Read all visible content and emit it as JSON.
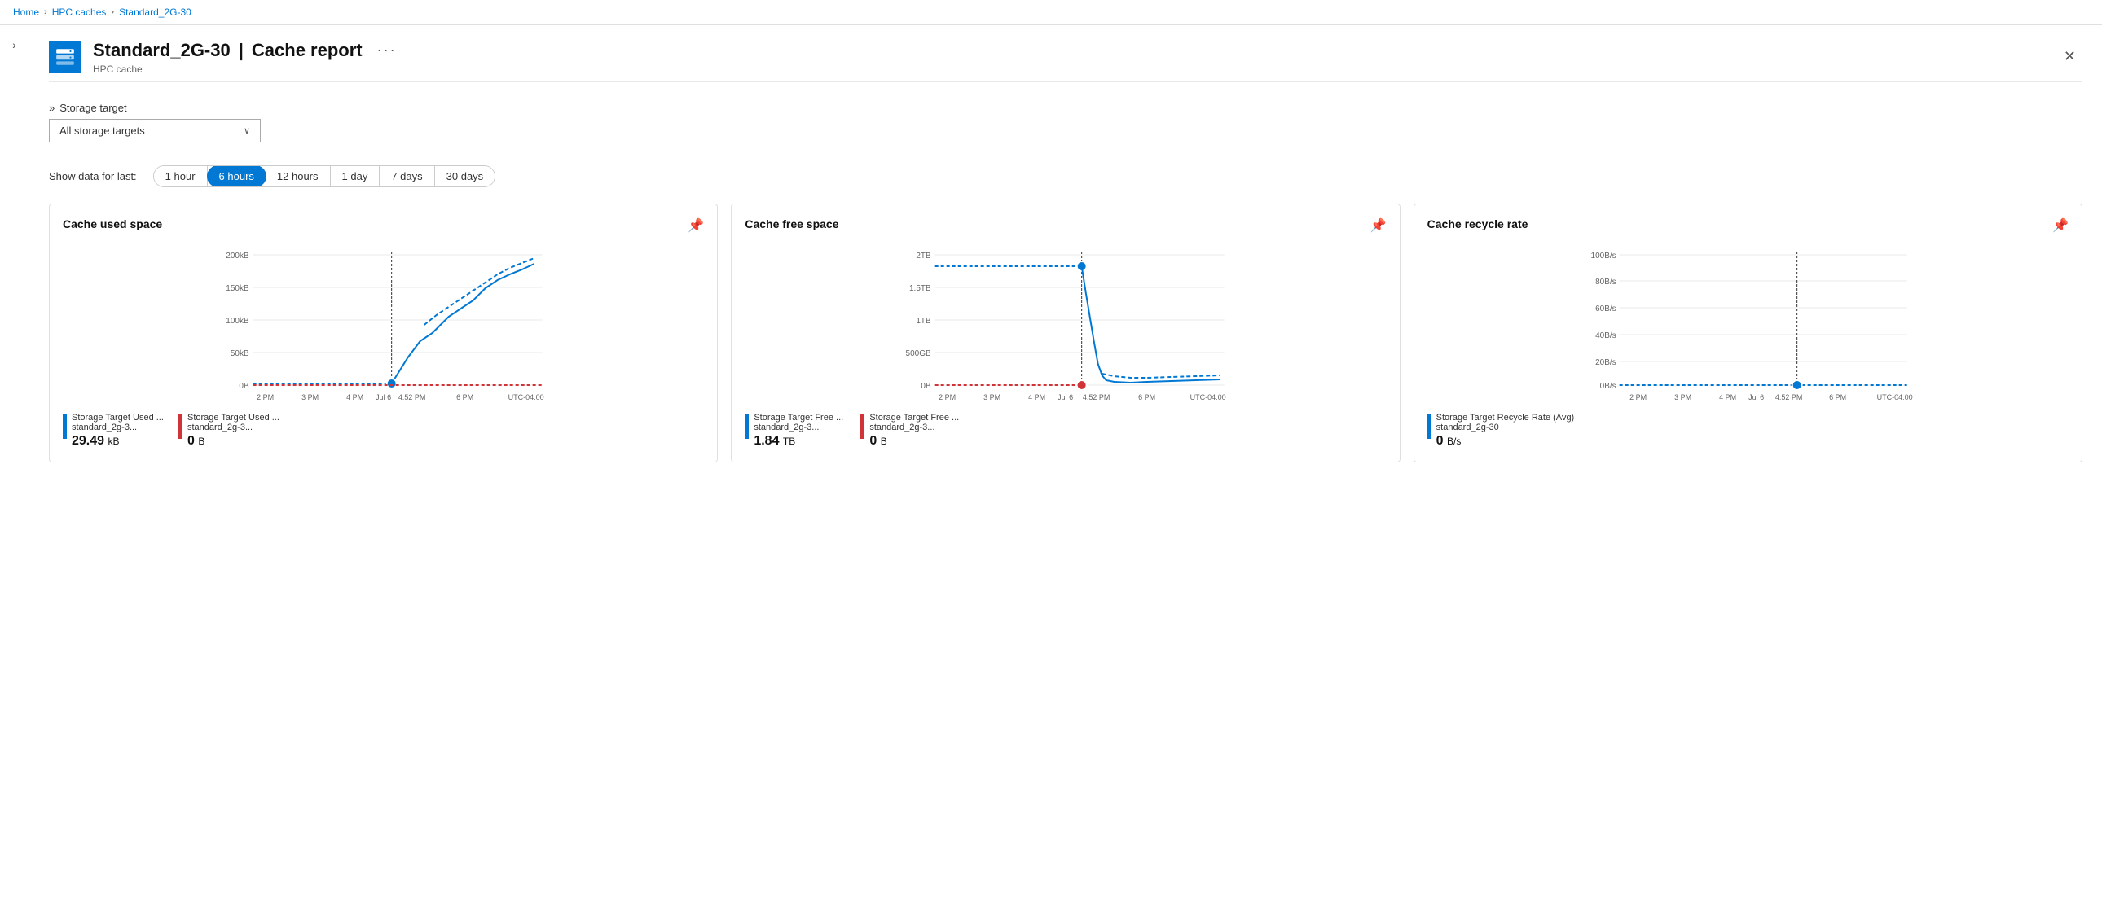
{
  "breadcrumb": {
    "items": [
      "Home",
      "HPC caches",
      "Standard_2G-30"
    ]
  },
  "header": {
    "title": "Standard_2G-30",
    "separator": "|",
    "subtitle_part": "Cache report",
    "resource_type": "HPC cache",
    "more_label": "···",
    "close_label": "✕"
  },
  "filter": {
    "section_label": "Storage target",
    "dropdown_value": "All storage targets",
    "double_chevron": "»"
  },
  "time_filter": {
    "label": "Show data for last:",
    "options": [
      "1 hour",
      "6 hours",
      "12 hours",
      "1 day",
      "7 days",
      "30 days"
    ],
    "active_index": 1
  },
  "charts": [
    {
      "id": "cache-used-space",
      "title": "Cache used space",
      "y_labels": [
        "200kB",
        "150kB",
        "100kB",
        "50kB",
        "0B"
      ],
      "x_labels": [
        "2 PM",
        "3 PM",
        "4 PM",
        "Jul 6",
        "4:52 PM",
        "6 PM",
        "UTC-04:00"
      ],
      "legend": [
        {
          "color": "#0078d4",
          "label": "Storage Target Used ...",
          "sub": "standard_2g-3...",
          "value": "29.49",
          "unit": "kB"
        },
        {
          "color": "#d13438",
          "label": "Storage Target Used ...",
          "sub": "standard_2g-3...",
          "value": "0",
          "unit": "B"
        }
      ]
    },
    {
      "id": "cache-free-space",
      "title": "Cache free space",
      "y_labels": [
        "2TB",
        "1.5TB",
        "1TB",
        "500GB",
        "0B"
      ],
      "x_labels": [
        "2 PM",
        "3 PM",
        "4 PM",
        "Jul 6",
        "4:52 PM",
        "6 PM",
        "UTC-04:00"
      ],
      "legend": [
        {
          "color": "#0078d4",
          "label": "Storage Target Free ...",
          "sub": "standard_2g-3...",
          "value": "1.84",
          "unit": "TB"
        },
        {
          "color": "#d13438",
          "label": "Storage Target Free ...",
          "sub": "standard_2g-3...",
          "value": "0",
          "unit": "B"
        }
      ]
    },
    {
      "id": "cache-recycle-rate",
      "title": "Cache recycle rate",
      "y_labels": [
        "100B/s",
        "80B/s",
        "60B/s",
        "40B/s",
        "20B/s",
        "0B/s"
      ],
      "x_labels": [
        "2 PM",
        "3 PM",
        "4 PM",
        "Jul 6",
        "4:52 PM",
        "6 PM",
        "UTC-04:00"
      ],
      "legend": [
        {
          "color": "#0078d4",
          "label": "Storage Target Recycle Rate (Avg)",
          "sub": "standard_2g-30",
          "value": "0",
          "unit": "B/s"
        }
      ]
    }
  ],
  "icons": {
    "pin": "⊹",
    "chevron_right": "›",
    "double_chevron": "»"
  }
}
